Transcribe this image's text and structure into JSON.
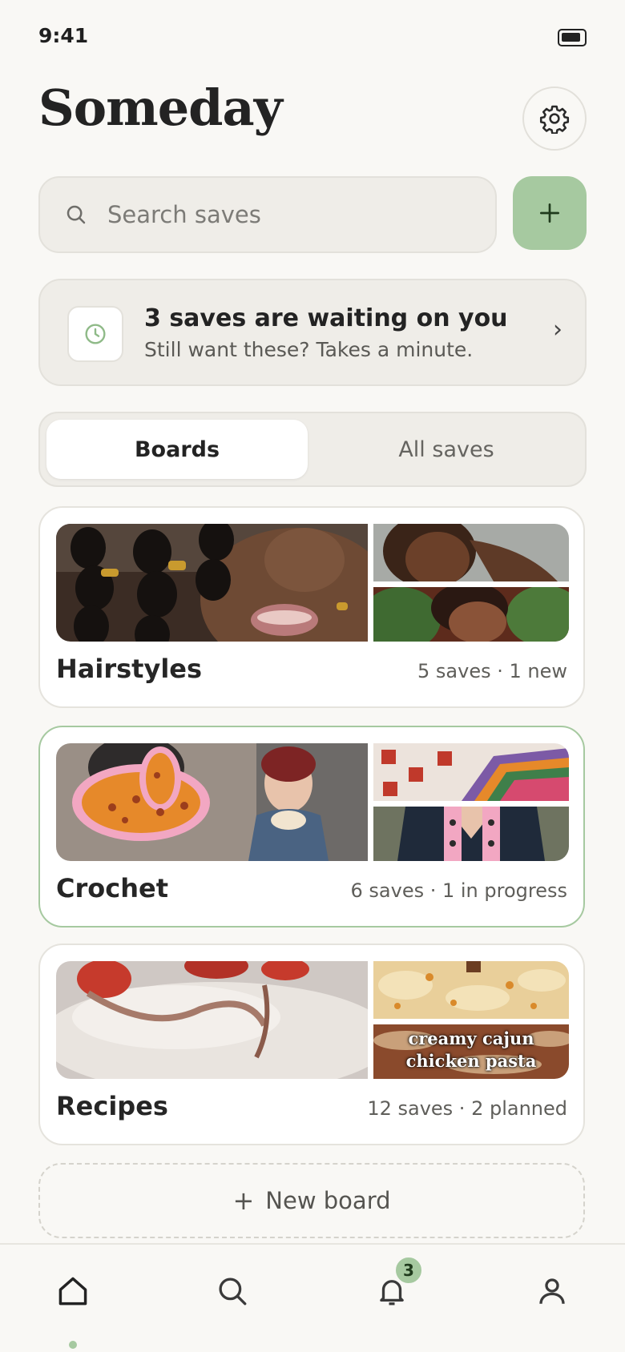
{
  "status": {
    "time": "9:41"
  },
  "header": {
    "title": "Someday"
  },
  "search": {
    "placeholder": "Search saves"
  },
  "banner": {
    "title": "3 saves are waiting on you",
    "subtitle": "Still want these? Takes a minute.",
    "chevron": "›"
  },
  "segments": {
    "boards": "Boards",
    "all_saves": "All saves"
  },
  "boards": [
    {
      "name": "Hairstyles",
      "meta": "5 saves · 1 new"
    },
    {
      "name": "Crochet",
      "meta": "6 saves · 1 in progress"
    },
    {
      "name": "Recipes",
      "meta": "12 saves · 2 planned",
      "thumb_caption": "creamy cajun chicken pasta"
    }
  ],
  "new_board": {
    "plus": "+",
    "label": "New board"
  },
  "tabbar": {
    "notifications_badge": "3"
  },
  "colors": {
    "accent": "#a6c9a0",
    "background": "#f9f8f5",
    "surface": "#efede8"
  }
}
